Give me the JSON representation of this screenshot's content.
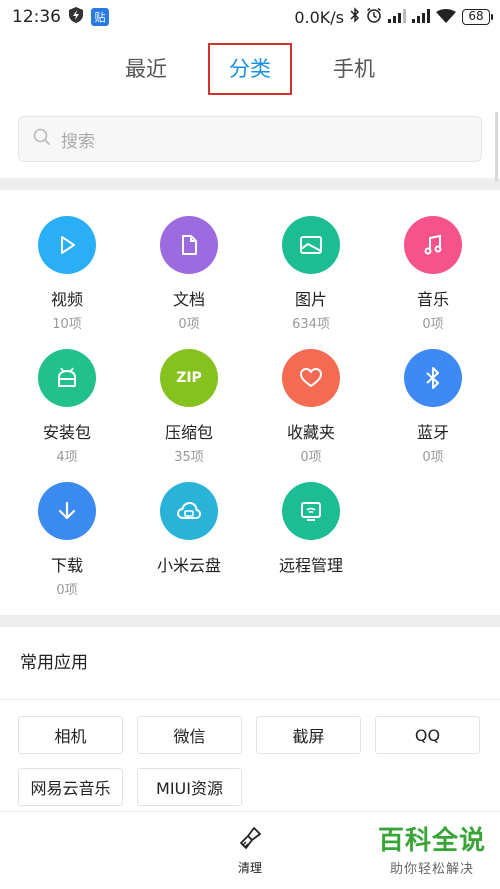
{
  "status": {
    "time": "12:36",
    "paste_badge": "贴",
    "net_speed": "0.0K/s",
    "battery": "68"
  },
  "tabs": [
    {
      "label": "最近",
      "active": false
    },
    {
      "label": "分类",
      "active": true
    },
    {
      "label": "手机",
      "active": false
    }
  ],
  "search": {
    "placeholder": "搜索"
  },
  "categories": [
    {
      "label": "视频",
      "count": "10项",
      "color": "#2aaef5",
      "icon": "play-icon"
    },
    {
      "label": "文档",
      "count": "0项",
      "color": "#9d6be0",
      "icon": "document-icon"
    },
    {
      "label": "图片",
      "count": "634项",
      "color": "#1dbd93",
      "icon": "image-icon"
    },
    {
      "label": "音乐",
      "count": "0项",
      "color": "#f5538a",
      "icon": "music-icon"
    },
    {
      "label": "安装包",
      "count": "4项",
      "color": "#22c08a",
      "icon": "android-icon"
    },
    {
      "label": "压缩包",
      "count": "35项",
      "color": "#86c21e",
      "icon": "zip-icon",
      "icon_text": "ZIP"
    },
    {
      "label": "收藏夹",
      "count": "0项",
      "color": "#f56a52",
      "icon": "heart-icon"
    },
    {
      "label": "蓝牙",
      "count": "0项",
      "color": "#3e8af2",
      "icon": "bluetooth-icon"
    },
    {
      "label": "下载",
      "count": "0项",
      "color": "#3a8af0",
      "icon": "download-icon"
    },
    {
      "label": "小米云盘",
      "count": "",
      "color": "#2ab3d8",
      "icon": "cloud-disk-icon"
    },
    {
      "label": "远程管理",
      "count": "",
      "color": "#1dbd93",
      "icon": "remote-manage-icon"
    }
  ],
  "common_apps": {
    "title": "常用应用",
    "items": [
      "相机",
      "微信",
      "截屏",
      "QQ",
      "网易云音乐",
      "MIUI资源"
    ]
  },
  "bottom": {
    "clean_label": "清理",
    "watermark_title": "百科全说",
    "watermark_sub": "助你轻松解决"
  }
}
